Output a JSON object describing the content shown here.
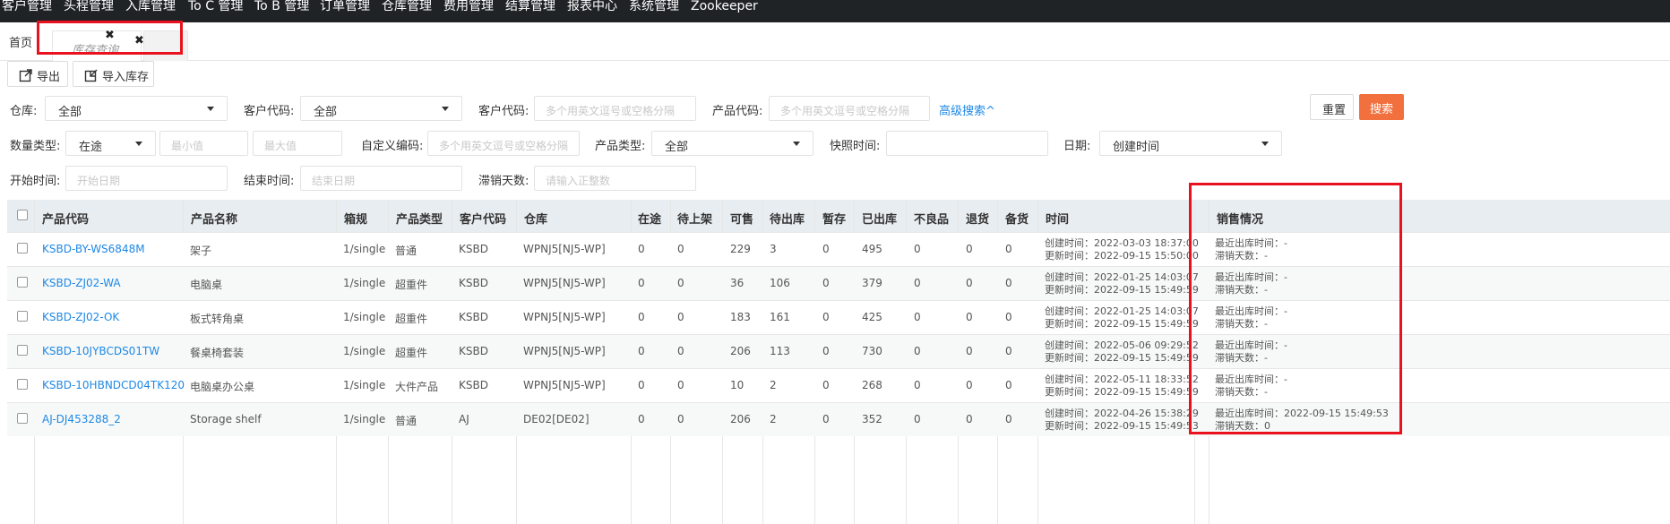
{
  "nav": {
    "items": [
      "客户管理",
      "头程管理",
      "入库管理",
      "To C 管理",
      "To B 管理",
      "订单管理",
      "仓库管理",
      "费用管理",
      "结算管理",
      "报表中心",
      "系统管理",
      "Zookeeper"
    ]
  },
  "tabs": {
    "home": "首页",
    "active": "库存查询"
  },
  "toolbar": {
    "export": "导出",
    "import": "导入库存"
  },
  "filters": {
    "warehouse_label": "仓库:",
    "warehouse_value": "全部",
    "customer_code_label": "客户代码:",
    "customer_code_value": "全部",
    "customer_code2_label": "客户代码:",
    "customer_code2_placeholder": "多个用英文逗号或空格分隔",
    "product_code_label": "产品代码:",
    "product_code_placeholder": "多个用英文逗号或空格分隔",
    "advanced": "高级搜索^",
    "qty_type_label": "数量类型:",
    "qty_type_value": "在途",
    "min_placeholder": "最小值",
    "max_placeholder": "最大值",
    "custom_code_label": "自定义编码:",
    "custom_code_placeholder": "多个用英文逗号或空格分隔",
    "product_type_label": "产品类型:",
    "product_type_value": "全部",
    "snapshot_label": "快照时间:",
    "date_label": "日期:",
    "date_value": "创建时间",
    "start_label": "开始时间:",
    "start_placeholder": "开始日期",
    "end_label": "结束时间:",
    "end_placeholder": "结束日期",
    "stagnant_label": "滞销天数:",
    "stagnant_placeholder": "请输入正整数",
    "reset": "重置",
    "search": "搜索"
  },
  "table": {
    "headers": [
      "产品代码",
      "产品名称",
      "箱规",
      "产品类型",
      "客户代码",
      "仓库",
      "在途",
      "待上架",
      "可售",
      "待出库",
      "暂存",
      "已出库",
      "不良品",
      "退货",
      "备货",
      "时间",
      "销售情况"
    ],
    "rows": [
      {
        "code": "KSBD-BY-WS6848M",
        "name": "架子",
        "box": "1/single",
        "type": "普通",
        "customer": "KSBD",
        "warehouse": "WPNJ5[NJ5-WP]",
        "transit": "0",
        "pending_shelf": "0",
        "sellable": "229",
        "pending_out": "3",
        "temp": "0",
        "shipped": "495",
        "defective": "0",
        "returned": "0",
        "stock": "0",
        "created": "创建时间：2022-03-03 18:37:00",
        "updated": "更新时间：2022-09-15 15:50:00",
        "last_out": "最近出库时间：-",
        "stagnant": "滞销天数：-"
      },
      {
        "code": "KSBD-ZJ02-WA",
        "name": "电脑桌",
        "box": "1/single",
        "type": "超重件",
        "customer": "KSBD",
        "warehouse": "WPNJ5[NJ5-WP]",
        "transit": "0",
        "pending_shelf": "0",
        "sellable": "36",
        "pending_out": "106",
        "temp": "0",
        "shipped": "379",
        "defective": "0",
        "returned": "0",
        "stock": "0",
        "created": "创建时间：2022-01-25 14:03:07",
        "updated": "更新时间：2022-09-15 15:49:59",
        "last_out": "最近出库时间：-",
        "stagnant": "滞销天数：-"
      },
      {
        "code": "KSBD-ZJ02-OK",
        "name": "板式转角桌",
        "box": "1/single",
        "type": "超重件",
        "customer": "KSBD",
        "warehouse": "WPNJ5[NJ5-WP]",
        "transit": "0",
        "pending_shelf": "0",
        "sellable": "183",
        "pending_out": "161",
        "temp": "0",
        "shipped": "425",
        "defective": "0",
        "returned": "0",
        "stock": "0",
        "created": "创建时间：2022-01-25 14:03:07",
        "updated": "更新时间：2022-09-15 15:49:59",
        "last_out": "最近出库时间：-",
        "stagnant": "滞销天数：-"
      },
      {
        "code": "KSBD-10JYBCDS01TW",
        "name": "餐桌椅套装",
        "box": "1/single",
        "type": "超重件",
        "customer": "KSBD",
        "warehouse": "WPNJ5[NJ5-WP]",
        "transit": "0",
        "pending_shelf": "0",
        "sellable": "206",
        "pending_out": "113",
        "temp": "0",
        "shipped": "730",
        "defective": "0",
        "returned": "0",
        "stock": "0",
        "created": "创建时间：2022-05-06 09:29:52",
        "updated": "更新时间：2022-09-15 15:49:59",
        "last_out": "最近出库时间：-",
        "stagnant": "滞销天数：-"
      },
      {
        "code": "KSBD-10HBNDCD04TK120",
        "name": "电脑桌办公桌",
        "box": "1/single",
        "type": "大件产品",
        "customer": "KSBD",
        "warehouse": "WPNJ5[NJ5-WP]",
        "transit": "0",
        "pending_shelf": "0",
        "sellable": "10",
        "pending_out": "2",
        "temp": "0",
        "shipped": "268",
        "defective": "0",
        "returned": "0",
        "stock": "0",
        "created": "创建时间：2022-05-11 18:33:52",
        "updated": "更新时间：2022-09-15 15:49:59",
        "last_out": "最近出库时间：-",
        "stagnant": "滞销天数：-"
      },
      {
        "code": "AJ-DJ453288_2",
        "name": "Storage shelf",
        "box": "1/single",
        "type": "普通",
        "customer": "AJ",
        "warehouse": "DE02[DE02]",
        "transit": "0",
        "pending_shelf": "0",
        "sellable": "206",
        "pending_out": "2",
        "temp": "0",
        "shipped": "352",
        "defective": "0",
        "returned": "0",
        "stock": "0",
        "created": "创建时间：2022-04-26 15:38:29",
        "updated": "更新时间：2022-09-15 15:49:53",
        "last_out": "最近出库时间：2022-09-15 15:49:53",
        "stagnant": "滞销天数：0"
      }
    ]
  },
  "colors": {
    "nav_bg": "#1f2326",
    "highlight": "#e8111d",
    "link": "#1e88e5",
    "search_btn": "#f2703e"
  }
}
